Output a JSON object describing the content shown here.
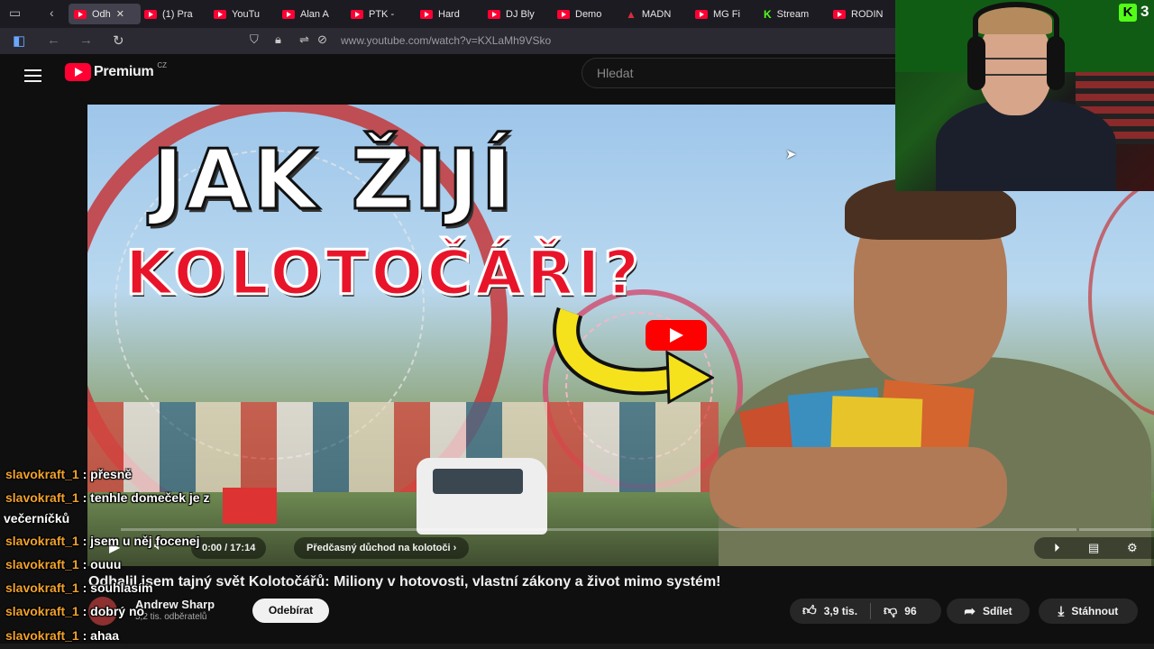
{
  "browser": {
    "tabs": [
      {
        "label": "Odh",
        "favicon": "youtube-icon",
        "active": true
      },
      {
        "label": "(1) Pra",
        "favicon": "youtube-icon"
      },
      {
        "label": "YouTu",
        "favicon": "youtube-icon"
      },
      {
        "label": "Alan A",
        "favicon": "youtube-icon"
      },
      {
        "label": "PTK -",
        "favicon": "youtube-icon"
      },
      {
        "label": "Hard",
        "favicon": "youtube-icon"
      },
      {
        "label": "DJ Bly",
        "favicon": "youtube-icon"
      },
      {
        "label": "Demo",
        "favicon": "youtube-icon"
      },
      {
        "label": "MADN",
        "favicon": "madness-icon"
      },
      {
        "label": "MG Fi",
        "favicon": "youtube-icon"
      },
      {
        "label": "Stream",
        "favicon": "kick-icon"
      },
      {
        "label": "RODIN",
        "favicon": "youtube-icon"
      }
    ],
    "url": "www.youtube.com/watch?v=KXLaMh9VSko"
  },
  "youtube": {
    "logo_text": "Premium",
    "logo_country": "CZ",
    "search_placeholder": "Hledat"
  },
  "video": {
    "thumbnail_title_line1": "JAK ŽIJÍ",
    "thumbnail_title_line2": "KOLOTOČÁŘI?",
    "time": "0:00 / 17:14",
    "chapter": "Předčasný důchod na kolotoči",
    "progress": 0
  },
  "meta": {
    "title": "Odhalil jsem tajný svět Kolotočářů: Miliony v hotovosti, vlastní zákony a život mimo systém!",
    "channel_name": "Andrew Sharp",
    "subscribers": "5,2 tis. odběratelů",
    "subscribe_label": "Odebírat",
    "likes": "3,9 tis.",
    "dislikes": "96",
    "share_label": "Sdílet",
    "download_label": "Stáhnout"
  },
  "chat": [
    {
      "user": "slavokraft_1",
      "text": "přesně"
    },
    {
      "user": "slavokraft_1",
      "text": "tenhle domeček je z",
      "wrap": "večerníčků"
    },
    {
      "user": "slavokraft_1",
      "text": "jsem u něj focenej"
    },
    {
      "user": "slavokraft_1",
      "text": "ouuu"
    },
    {
      "user": "slavokraft_1",
      "text": "souhlasím"
    },
    {
      "user": "slavokraft_1",
      "text": "dobrý no"
    },
    {
      "user": "slavokraft_1",
      "text": "ahaa"
    }
  ],
  "overlay": {
    "kick_count": "3"
  },
  "colors": {
    "chat_user": "#f1a22b",
    "youtube_red": "#ff0033",
    "kick_green": "#53fc18"
  }
}
